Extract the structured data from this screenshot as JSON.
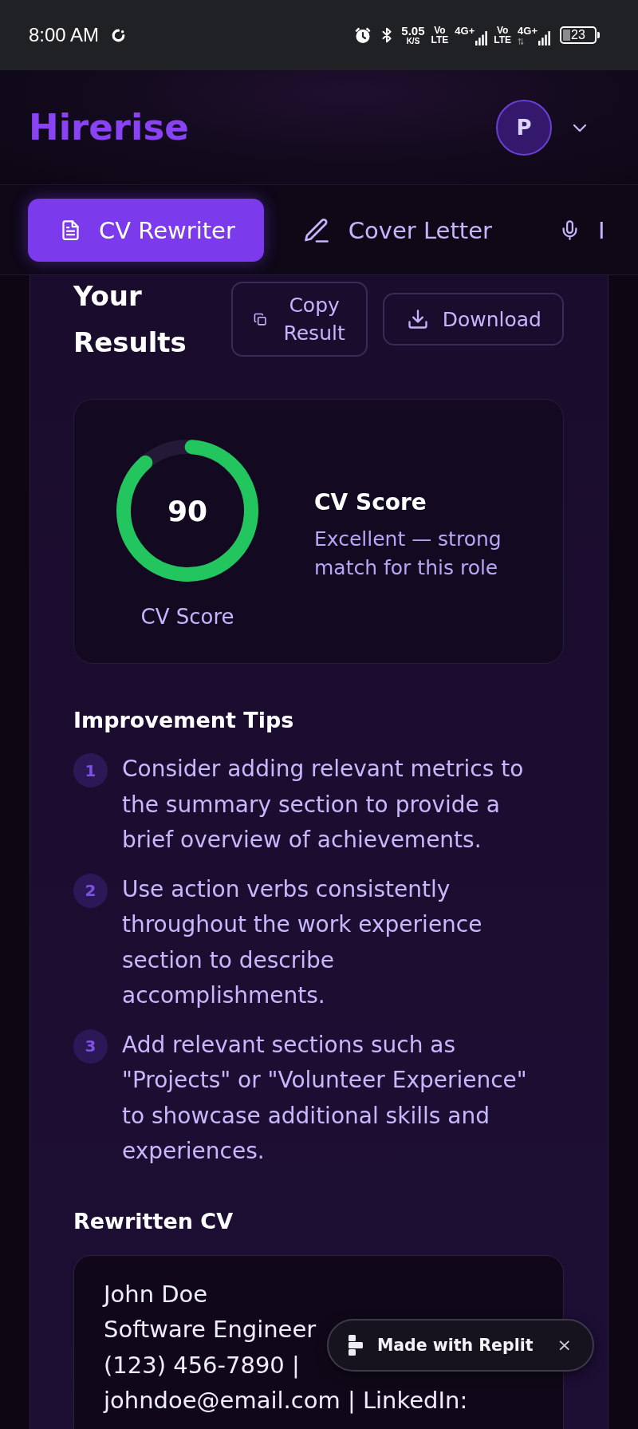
{
  "status_bar": {
    "time": "8:00 AM",
    "speed": "5.05",
    "speed_unit": "K/S",
    "sims": [
      {
        "volte": [
          "Vo",
          "LTE"
        ],
        "network": "4G+",
        "data_arrows": false
      },
      {
        "volte": [
          "Vo",
          "LTE"
        ],
        "network": "4G+",
        "data_arrows": true
      }
    ],
    "battery": "23"
  },
  "header": {
    "logo": "Hirerise",
    "avatar": "P"
  },
  "tabs": [
    {
      "label": "CV Rewriter",
      "selected": true
    },
    {
      "label": "Cover Letter",
      "selected": false
    },
    {
      "label": "I",
      "selected": false
    }
  ],
  "results": {
    "title": "Your Results",
    "actions": [
      "Copy Result",
      "Download"
    ]
  },
  "score": {
    "value": "90",
    "level": 0.9,
    "ring_label": "CV Score",
    "title": "CV Score",
    "description": "Excellent — strong match for this role"
  },
  "tips": {
    "title": "Improvement Tips",
    "items": [
      {
        "number": "1",
        "text": "Consider adding relevant metrics to the summary section to provide a brief overview of achievements."
      },
      {
        "number": "2",
        "text": "Use action verbs consistently throughout the work experience section to describe accomplishments."
      },
      {
        "number": "3",
        "text": "Add relevant sections such as \"Projects\" or \"Volunteer Experience\" to showcase additional skills and experiences."
      }
    ]
  },
  "rewritten_cv": {
    "title": "Rewritten CV",
    "lines": [
      "John Doe",
      "Software Engineer",
      "(123) 456-7890 |",
      "johndoe@email.com | LinkedIn:"
    ]
  },
  "replit_badge": {
    "label": "Made with Replit",
    "close": "×"
  }
}
